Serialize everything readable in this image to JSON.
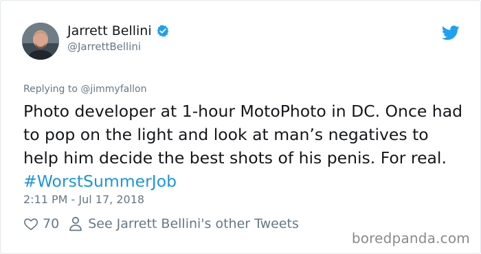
{
  "tweet": {
    "author_name": "Jarrett Bellini",
    "author_handle": "@JarrettBellini",
    "replying_to": "Replying to @jimmyfallon",
    "text_main": "Photo developer at 1-hour MotoPhoto in DC. Once had to pop on the light and look at man’s negatives to help him decide the best shots of his penis. For real. ",
    "hashtag": "#WorstSummerJob",
    "timestamp": "2:11 PM - Jul 17, 2018",
    "like_count": "70",
    "other_tweets_label": "See Jarrett Bellini's other Tweets"
  },
  "icons": {
    "verified": "verified-badge-icon",
    "twitter": "twitter-bird-icon",
    "like": "heart-icon",
    "profile": "person-icon"
  },
  "colors": {
    "accent": "#1da1f2",
    "hashtag": "#1b95e0",
    "muted": "#657786"
  },
  "watermark": "boredpanda.com"
}
